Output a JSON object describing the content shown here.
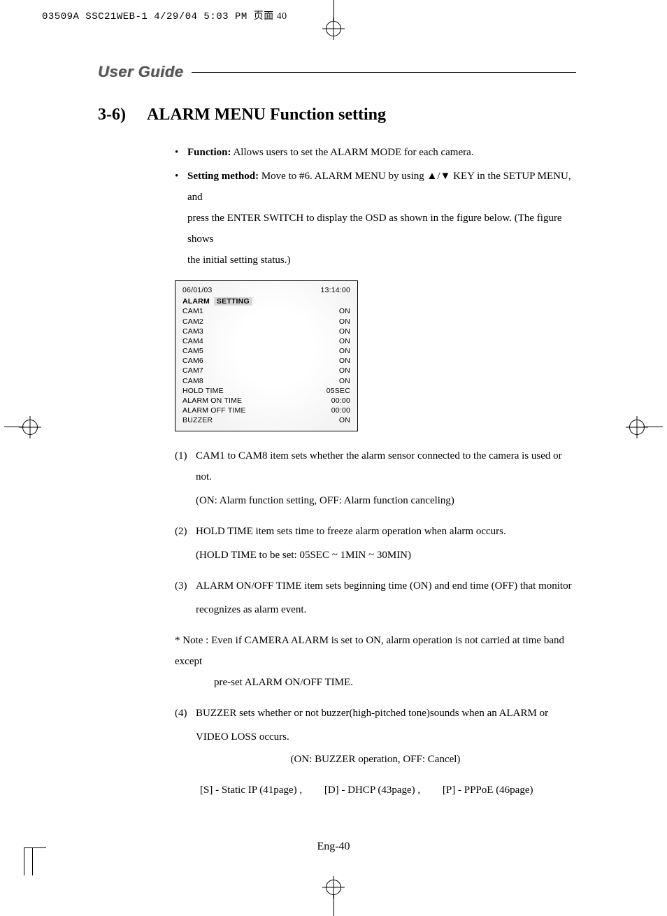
{
  "slug": {
    "text": "03509A SSC21WEB-1  4/29/04  5:03 PM  ",
    "cjk": "页面 40"
  },
  "header": {
    "title": "User Guide"
  },
  "section": {
    "number": "3-6)",
    "title": "ALARM MENU Function setting"
  },
  "bullets": {
    "function_label": "Function:",
    "function_text": " Allows users to set the ALARM MODE for each camera.",
    "setting_label": "Setting method:",
    "setting_text_1": " Move to #6. ALARM MENU by using  ▲/▼ KEY in the SETUP MENU, and",
    "setting_text_2": "press the ENTER SWITCH to display the OSD as shown in the figure below.  (The figure shows",
    "setting_text_3": "the initial setting status.)"
  },
  "osd": {
    "date": "06/01/03",
    "time": "13:14:00",
    "title_left": "ALARM",
    "title_tab": "SETTING",
    "rows": [
      {
        "label": "CAM1",
        "value": "ON"
      },
      {
        "label": "CAM2",
        "value": "ON"
      },
      {
        "label": "CAM3",
        "value": "ON"
      },
      {
        "label": "CAM4",
        "value": "ON"
      },
      {
        "label": "CAM5",
        "value": "ON"
      },
      {
        "label": "CAM6",
        "value": "ON"
      },
      {
        "label": "CAM7",
        "value": "ON"
      },
      {
        "label": "CAM8",
        "value": "ON"
      },
      {
        "label": "HOLD TIME",
        "value": "05SEC"
      },
      {
        "label": "ALARM ON TIME",
        "value": "00:00"
      },
      {
        "label": "ALARM OFF TIME",
        "value": "00:00"
      },
      {
        "label": "BUZZER",
        "value": "ON"
      }
    ]
  },
  "items": {
    "i1_m": "(1)",
    "i1_a": "CAM1 to CAM8 item sets whether the alarm sensor connected to the camera is used or not.",
    "i1_b": "(ON: Alarm function setting, OFF: Alarm function canceling)",
    "i2_m": "(2)",
    "i2_a": "HOLD TIME item sets time to freeze alarm operation when alarm occurs.",
    "i2_b": "(HOLD TIME to be set: 05SEC ~ 1MIN ~ 30MIN)",
    "i3_m": "(3)",
    "i3_a": "ALARM ON/OFF TIME item sets beginning time (ON) and end time (OFF) that monitor",
    "i3_b": "recognizes as alarm event.",
    "note_a": "* Note : Even if CAMERA ALARM is set to ON, alarm operation is not carried at time band except",
    "note_b": "pre-set ALARM ON/OFF TIME.",
    "i4_m": "(4)",
    "i4_a": "BUZZER  sets whether or not buzzer(high-pitched tone)sounds when an ALARM or",
    "i4_b": "VIDEO LOSS occurs.",
    "i4_c": "(ON: BUZZER operation, OFF: Cancel)"
  },
  "refs": {
    "s": "[S] - Static IP (41page) ,",
    "d": "[D] - DHCP (43page) ,",
    "p": "[P] - PPPoE (46page)"
  },
  "page_number": "Eng-40"
}
